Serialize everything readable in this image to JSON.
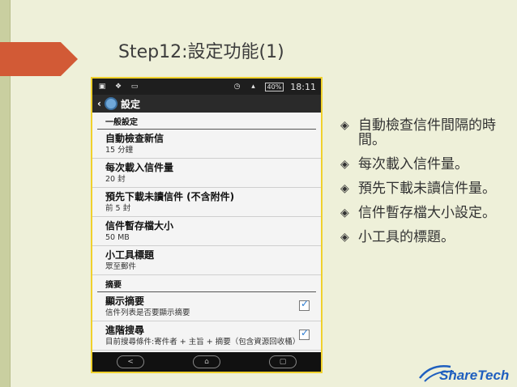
{
  "slide": {
    "title": "Step12:設定功能(1)"
  },
  "phone": {
    "status_bar": {
      "battery": "40%",
      "time": "18:11"
    },
    "action_bar": {
      "back": "‹",
      "title": "設定"
    },
    "sections": [
      {
        "header": "一般設定",
        "items": [
          {
            "title": "自動檢查新信",
            "summary": "15 分鐘"
          },
          {
            "title": "每次載入信件量",
            "summary": "20 封"
          },
          {
            "title": "預先下載未讀信件 (不含附件)",
            "summary": "前 5 封"
          },
          {
            "title": "信件暫存檔大小",
            "summary": "50 MB"
          },
          {
            "title": "小工具標題",
            "summary": "眾至郵件"
          }
        ]
      },
      {
        "header": "摘要",
        "items": [
          {
            "title": "顯示摘要",
            "summary": "信件列表是否要顯示摘要",
            "checked": true
          },
          {
            "title": "進階搜尋",
            "summary": "目前搜尋條件:寄件者 + 主旨 + 摘要（包含資源回收桶）",
            "checked": true
          }
        ]
      }
    ],
    "nav": {
      "back": "<",
      "home": "⌂",
      "recent": "▢"
    }
  },
  "bullets": [
    {
      "mark": "◈",
      "text": "自動檢查信件間隔的時間。"
    },
    {
      "mark": "◈",
      "text": "每次載入信件量。"
    },
    {
      "mark": "◈",
      "text": "預先下載未讀信件量。"
    },
    {
      "mark": "◈",
      "text": "信件暫存檔大小設定。"
    },
    {
      "mark": "◈",
      "text": "小工具的標題。"
    }
  ],
  "logo": {
    "text": "ShareTech",
    "color": "#1f5fbf"
  },
  "colors": {
    "background": "#eef0d9",
    "accent_arrow": "#d25a36",
    "frame_border": "#f0d12c"
  }
}
